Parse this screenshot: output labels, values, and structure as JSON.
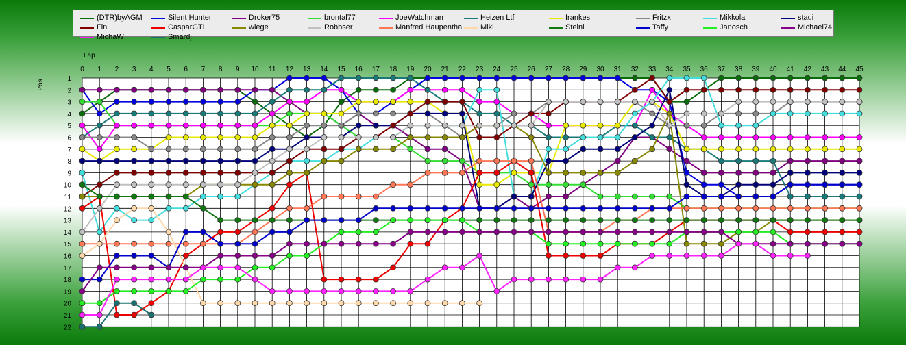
{
  "chart_data": {
    "type": "line",
    "title": "",
    "xlabel": "Lap",
    "ylabel": "Pos",
    "x": [
      0,
      1,
      2,
      3,
      4,
      5,
      6,
      7,
      8,
      9,
      10,
      11,
      12,
      13,
      14,
      15,
      16,
      17,
      18,
      19,
      20,
      21,
      22,
      23,
      24,
      25,
      26,
      27,
      28,
      29,
      30,
      31,
      32,
      33,
      34,
      35,
      36,
      37,
      38,
      39,
      40,
      41,
      42,
      43,
      44,
      45
    ],
    "y_categories": [
      1,
      2,
      3,
      4,
      5,
      6,
      7,
      8,
      9,
      10,
      11,
      12,
      13,
      14,
      15,
      16,
      17,
      18,
      19,
      20,
      21,
      22
    ],
    "xlim": [
      0,
      45
    ],
    "ylim": [
      1,
      22
    ],
    "y_inverted": true,
    "grid": true,
    "legend_position": "top",
    "series": [
      {
        "name": "(DTR)byAGM",
        "color": "#0a6b0a",
        "values": [
          4,
          3,
          2,
          2,
          2,
          2,
          2,
          2,
          2,
          2,
          3,
          4,
          5,
          6,
          5,
          3,
          2,
          2,
          2,
          1,
          1,
          1,
          1,
          1,
          1,
          1,
          1,
          1,
          1,
          1,
          1,
          1,
          1,
          1,
          3,
          3,
          2,
          1,
          1,
          1,
          1,
          1,
          1,
          1,
          1,
          1
        ]
      },
      {
        "name": "Silent Hunter",
        "color": "#0000e0",
        "values": [
          2,
          4,
          3,
          3,
          3,
          3,
          3,
          3,
          3,
          3,
          2,
          2,
          1,
          1,
          1,
          2,
          4,
          4,
          3,
          2,
          1,
          1,
          1,
          1,
          1,
          1,
          1,
          1,
          1,
          1,
          1,
          1,
          2,
          2,
          3,
          9,
          10,
          10,
          11,
          11,
          11,
          10,
          10,
          10,
          10,
          10
        ]
      },
      {
        "name": "Droker75",
        "color": "#800080",
        "values": [
          2,
          2,
          2,
          2,
          2,
          2,
          2,
          2,
          2,
          2,
          2,
          2,
          3,
          4,
          4,
          5,
          4,
          5,
          5,
          6,
          7,
          7,
          8,
          12,
          12,
          11,
          12,
          11,
          11,
          10,
          9,
          8,
          6,
          6,
          7,
          8,
          9,
          9,
          9,
          9,
          9,
          8,
          8,
          8,
          8,
          8
        ]
      },
      {
        "name": "brontal77",
        "color": "#33dd33",
        "values": [
          3,
          3,
          5,
          5,
          5,
          5,
          5,
          5,
          5,
          5,
          5,
          5,
          4,
          4,
          4,
          5,
          6,
          6,
          6,
          7,
          8,
          8,
          8,
          9,
          9,
          9,
          10,
          10,
          10,
          10,
          11,
          11,
          11,
          11,
          11,
          12,
          12,
          12,
          12,
          12,
          12,
          12,
          12,
          12,
          12,
          12
        ]
      },
      {
        "name": "JoeWatchman",
        "color": "#ff00ff",
        "values": [
          5,
          7,
          5,
          5,
          5,
          5,
          5,
          5,
          5,
          5,
          5,
          4,
          3,
          3,
          2,
          2,
          3,
          3,
          3,
          2,
          2,
          2,
          2,
          3,
          3,
          4,
          4,
          5,
          5,
          5,
          5,
          5,
          5,
          2,
          4,
          5,
          6,
          6,
          6,
          6,
          6,
          6,
          6,
          6,
          6,
          6
        ]
      },
      {
        "name": "Heizen Ltf",
        "color": "#1a7a7a",
        "values": [
          6,
          5,
          4,
          4,
          4,
          4,
          4,
          4,
          4,
          4,
          4,
          3,
          2,
          2,
          2,
          1,
          1,
          1,
          1,
          1,
          2,
          3,
          3,
          4,
          4,
          5,
          5,
          6,
          6,
          6,
          6,
          5,
          5,
          6,
          6,
          7,
          7,
          8,
          8,
          8,
          8,
          11,
          11,
          11,
          11,
          11
        ]
      },
      {
        "name": "frankes",
        "color": "#e8e800",
        "values": [
          7,
          8,
          7,
          7,
          7,
          6,
          6,
          6,
          6,
          6,
          6,
          5,
          5,
          4,
          4,
          4,
          3,
          3,
          3,
          3,
          3,
          4,
          4,
          10,
          10,
          9,
          9,
          9,
          5,
          5,
          5,
          5,
          3,
          3,
          4,
          7,
          7,
          7,
          7,
          7,
          7,
          7,
          7,
          7,
          7,
          7
        ]
      },
      {
        "name": "Fritzx",
        "color": "#888888",
        "values": [
          6,
          6,
          6,
          6,
          7,
          7,
          7,
          7,
          7,
          7,
          7,
          6,
          6,
          5,
          5,
          5,
          4,
          4,
          4,
          4,
          4,
          5,
          6,
          5,
          5,
          4,
          4,
          3,
          3,
          3,
          3,
          3,
          3,
          4,
          5,
          5,
          5,
          4,
          4,
          4,
          4,
          3,
          3,
          3,
          3,
          3
        ]
      },
      {
        "name": "Mikkola",
        "color": "#44dddd",
        "values": [
          9,
          14,
          12,
          13,
          13,
          12,
          12,
          11,
          11,
          11,
          10,
          9,
          8,
          8,
          8,
          7,
          7,
          6,
          6,
          5,
          5,
          5,
          5,
          2,
          2,
          11,
          11,
          7,
          7,
          6,
          6,
          6,
          4,
          3,
          1,
          1,
          1,
          5,
          5,
          5,
          4,
          4,
          4,
          4,
          4,
          4
        ]
      },
      {
        "name": "staui",
        "color": "#00007a",
        "values": [
          8,
          8,
          8,
          8,
          8,
          8,
          8,
          8,
          8,
          8,
          8,
          7,
          7,
          6,
          6,
          6,
          5,
          5,
          5,
          4,
          4,
          4,
          4,
          12,
          12,
          11,
          11,
          8,
          8,
          7,
          7,
          7,
          6,
          5,
          2,
          10,
          11,
          11,
          10,
          10,
          10,
          9,
          9,
          9,
          9,
          9
        ]
      },
      {
        "name": "Fin",
        "color": "#800000",
        "values": [
          11,
          10,
          9,
          9,
          9,
          9,
          9,
          9,
          9,
          9,
          9,
          9,
          8,
          7,
          7,
          7,
          6,
          6,
          5,
          4,
          3,
          3,
          3,
          6,
          6,
          5,
          4,
          4,
          3,
          3,
          3,
          3,
          2,
          1,
          3,
          2,
          2,
          2,
          2,
          2,
          2,
          2,
          2,
          2,
          2,
          2
        ]
      },
      {
        "name": "CasparGTL",
        "color": "#ee0000",
        "values": [
          12,
          11,
          21,
          21,
          20,
          19,
          16,
          15,
          14,
          14,
          13,
          12,
          10,
          9,
          18,
          18,
          18,
          18,
          17,
          15,
          15,
          13,
          12,
          9,
          9,
          8,
          9,
          16,
          16,
          16,
          16,
          15,
          15,
          15,
          14,
          13,
          13,
          13,
          13,
          13,
          13,
          14,
          14,
          14,
          14,
          14
        ]
      },
      {
        "name": "wiege",
        "color": "#888800",
        "values": [
          11,
          11,
          11,
          11,
          11,
          11,
          11,
          10,
          10,
          10,
          10,
          10,
          9,
          9,
          8,
          8,
          7,
          7,
          7,
          6,
          6,
          6,
          6,
          5,
          5,
          5,
          6,
          9,
          9,
          9,
          9,
          9,
          8,
          7,
          4,
          15,
          15,
          15,
          14,
          14,
          13,
          13,
          13,
          13,
          13,
          13
        ]
      },
      {
        "name": "Robbser",
        "color": "#c0c0c0",
        "values": [
          14,
          12,
          10,
          10,
          10,
          10,
          10,
          10,
          10,
          10,
          9,
          8,
          7,
          7,
          6,
          6,
          6,
          6,
          6,
          5,
          5,
          5,
          5,
          5,
          5,
          5,
          5,
          3,
          3,
          3,
          3,
          3,
          3,
          3,
          5,
          4,
          4,
          4,
          3,
          3,
          3,
          3,
          3,
          3,
          3,
          3
        ]
      },
      {
        "name": "Manfred Haupenthal",
        "color": "#ff7755",
        "values": [
          15,
          15,
          15,
          15,
          15,
          15,
          15,
          15,
          15,
          15,
          14,
          13,
          12,
          12,
          11,
          11,
          11,
          11,
          10,
          10,
          9,
          9,
          9,
          8,
          8,
          8,
          8,
          14,
          14,
          14,
          14,
          13,
          13,
          12,
          12,
          12,
          12,
          12,
          12,
          12,
          12,
          12,
          12,
          12,
          12,
          12
        ]
      },
      {
        "name": "Miki",
        "color": "#ffd8aa",
        "values": [
          16,
          15,
          13,
          12,
          12,
          14,
          17,
          20,
          20,
          20,
          20,
          20,
          20,
          20,
          20,
          20,
          20,
          20,
          20,
          20,
          20,
          20,
          20,
          20
        ]
      },
      {
        "name": "Steini",
        "color": "#117711",
        "values": [
          10,
          11,
          11,
          11,
          11,
          11,
          11,
          12,
          13,
          13,
          13,
          13,
          13,
          13,
          13,
          13,
          13,
          13,
          13,
          13,
          13,
          13,
          13,
          13,
          13,
          13,
          13,
          13,
          13,
          13,
          13,
          13,
          13,
          13,
          13,
          13,
          13,
          13,
          13,
          13,
          13,
          13,
          13,
          13,
          13,
          13
        ]
      },
      {
        "name": "Taffy",
        "color": "#0000cc",
        "values": [
          18,
          18,
          16,
          16,
          16,
          17,
          14,
          14,
          15,
          15,
          15,
          14,
          14,
          13,
          13,
          13,
          13,
          12,
          12,
          12,
          12,
          12,
          12,
          12,
          12,
          12,
          12,
          12,
          12,
          12,
          12,
          12,
          12,
          12,
          12,
          11,
          11,
          11,
          11,
          11,
          11,
          10,
          10,
          10,
          10,
          10
        ]
      },
      {
        "name": "Janosch",
        "color": "#22ee22",
        "values": [
          20,
          20,
          19,
          19,
          19,
          19,
          19,
          18,
          18,
          18,
          17,
          17,
          16,
          16,
          15,
          14,
          14,
          14,
          13,
          13,
          13,
          13,
          13,
          14,
          14,
          14,
          14,
          15,
          15,
          15,
          15,
          15,
          15,
          15,
          15,
          14,
          14,
          14,
          14,
          14,
          14,
          15,
          15,
          15,
          15,
          15
        ]
      },
      {
        "name": "Michael74",
        "color": "#880088",
        "values": [
          19,
          17,
          17,
          17,
          17,
          17,
          17,
          17,
          16,
          16,
          16,
          16,
          15,
          15,
          15,
          15,
          15,
          15,
          15,
          14,
          14,
          14,
          14,
          14,
          14,
          14,
          14,
          14,
          14,
          14,
          14,
          14,
          14,
          14,
          14,
          14,
          14,
          14,
          15,
          15,
          15,
          15,
          15,
          15,
          15,
          15
        ]
      },
      {
        "name": "MichaW",
        "color": "#ff22ff",
        "values": [
          21,
          21,
          18,
          18,
          18,
          18,
          18,
          17,
          17,
          17,
          18,
          19,
          19,
          19,
          19,
          19,
          19,
          19,
          19,
          19,
          18,
          17,
          17,
          16,
          19,
          18,
          18,
          18,
          18,
          18,
          18,
          17,
          17,
          16,
          16,
          16,
          16,
          16,
          15,
          15,
          16,
          16,
          16
        ]
      },
      {
        "name": "Smardj",
        "color": "#1a7070",
        "values": [
          22,
          22,
          20,
          20,
          21
        ]
      }
    ]
  }
}
